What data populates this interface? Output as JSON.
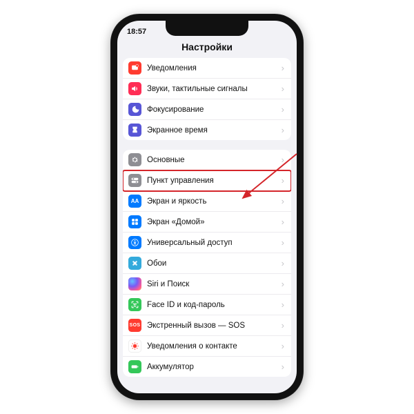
{
  "status": {
    "time": "18:57"
  },
  "header": {
    "title": "Настройки"
  },
  "groups": [
    {
      "rows": [
        {
          "label": "Уведомления"
        },
        {
          "label": "Звуки, тактильные сигналы"
        },
        {
          "label": "Фокусирование"
        },
        {
          "label": "Экранное время"
        }
      ]
    },
    {
      "rows": [
        {
          "label": "Основные"
        },
        {
          "label": "Пункт управления"
        },
        {
          "label": "Экран и яркость"
        },
        {
          "label": "Экран «Домой»"
        },
        {
          "label": "Универсальный доступ"
        },
        {
          "label": "Обои"
        },
        {
          "label": "Siri и Поиск"
        },
        {
          "label": "Face ID и код-пароль"
        },
        {
          "label": "Экстренный вызов — SOS"
        },
        {
          "label": "Уведомления о контакте"
        },
        {
          "label": "Аккумулятор"
        }
      ]
    }
  ],
  "sos_text": "SOS"
}
